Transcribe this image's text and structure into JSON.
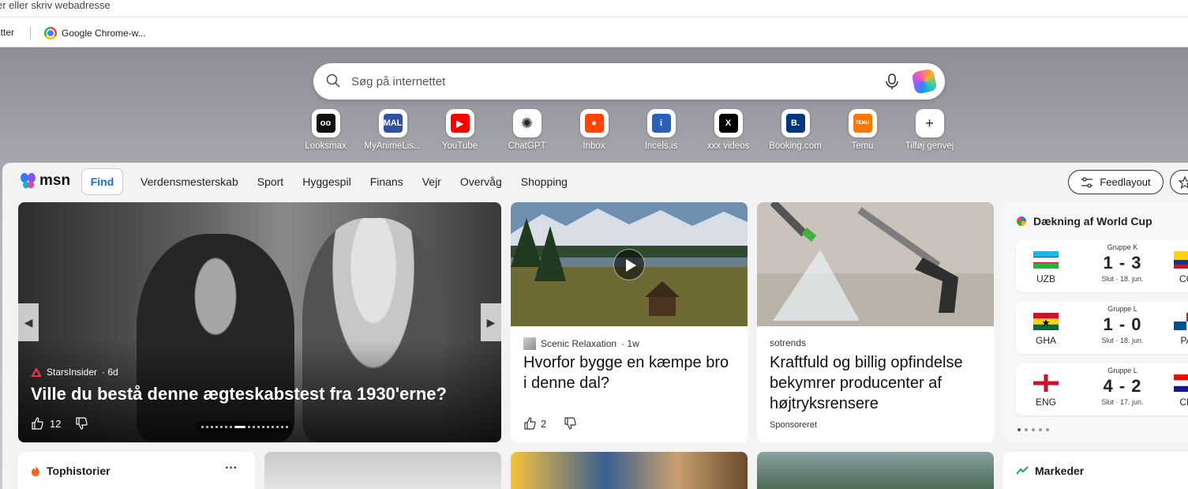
{
  "browser": {
    "address_text": "er eller skriv webadresse",
    "bookmarks": [
      {
        "label": "itter"
      },
      {
        "label": "Google Chrome-w..."
      }
    ]
  },
  "search": {
    "placeholder": "Søg på internettet"
  },
  "shortcuts": [
    {
      "label": "Looksmax",
      "icon": "looksmax-icon",
      "color": "#111111",
      "glyph": "oo"
    },
    {
      "label": "MyAnimeLis...",
      "icon": "myanimelist-icon",
      "color": "#2e51a2",
      "glyph": "MAL"
    },
    {
      "label": "YouTube",
      "icon": "youtube-icon",
      "color": "#ff0000",
      "glyph": "▶"
    },
    {
      "label": "ChatGPT",
      "icon": "chatgpt-icon",
      "color": "#ffffff",
      "glyph": "✺"
    },
    {
      "label": "Inbox",
      "icon": "reddit-icon",
      "color": "#ff4500",
      "glyph": "●"
    },
    {
      "label": "Incels.is",
      "icon": "incels-icon",
      "color": "#2b5fb8",
      "glyph": "i"
    },
    {
      "label": "xxx videos",
      "icon": "xvideos-icon",
      "color": "#000000",
      "glyph": "X"
    },
    {
      "label": "Booking.com",
      "icon": "booking-icon",
      "color": "#003580",
      "glyph": "B."
    },
    {
      "label": "Temu",
      "icon": "temu-icon",
      "color": "#fb7701",
      "glyph": "TEMU"
    },
    {
      "label": "Tilføj genvej",
      "icon": "plus-icon",
      "color": "#ffffff",
      "glyph": "+"
    }
  ],
  "msn": {
    "logo_text": "msn",
    "find_label": "Find",
    "nav_items": [
      "Verdensmesterskab",
      "Sport",
      "Hyggespil",
      "Finans",
      "Vejr",
      "Overvåg",
      "Shopping"
    ],
    "feedlayout_label": "Feedlayout"
  },
  "hero_card": {
    "source": "StarsInsider",
    "age": "· 6d",
    "title": "Ville du bestå denne ægteskabstest fra 1930'erne?",
    "likes": "12",
    "carousel_total": 17,
    "carousel_active": 7
  },
  "card2": {
    "source": "Scenic Relaxation",
    "age": "· 1w",
    "title": "Hvorfor bygge en kæmpe bro i denne dal?",
    "likes": "2"
  },
  "card3": {
    "source": "sotrends",
    "title": "Kraftfuld og billig opfindelse bekymrer producenter af højtryksrensere",
    "sponsored": "Sponsoreret"
  },
  "worldcup": {
    "header": "Dækning af World Cup",
    "matches": [
      {
        "group": "Gruppe K",
        "home": "UZB",
        "score": "1 - 3",
        "away": "CO",
        "date": "Slut · 18. jun."
      },
      {
        "group": "Gruppe L",
        "home": "GHA",
        "score": "1 - 0",
        "away": "PA",
        "date": "Slut · 18. jun."
      },
      {
        "group": "Gruppe L",
        "home": "ENG",
        "score": "4 - 2",
        "away": "CR",
        "date": "Slut · 17. jun."
      }
    ]
  },
  "bottom": {
    "top_stories": "Tophistorier",
    "more": "···",
    "markets": "Markeder"
  }
}
